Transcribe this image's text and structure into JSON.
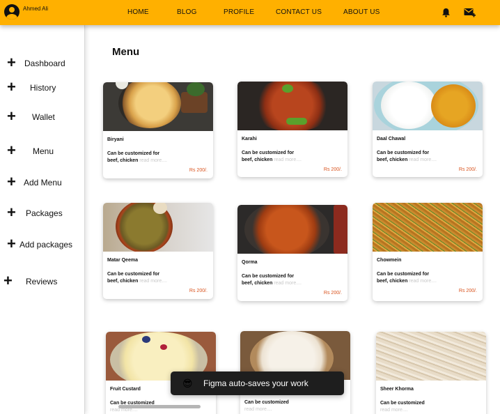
{
  "user": {
    "name": "Ahmed Ali"
  },
  "nav": [
    {
      "label": "HOME"
    },
    {
      "label": "BLOG"
    },
    {
      "label": "PROFILE"
    },
    {
      "label": "CONTACT US"
    },
    {
      "label": "ABOUT US"
    }
  ],
  "icons": {
    "notifications": "bell-icon",
    "messages": "mail-plus-icon",
    "avatar": "user-avatar-icon"
  },
  "sidebar": {
    "items": [
      {
        "label": "Dashboard"
      },
      {
        "label": "History"
      },
      {
        "label": "Wallet"
      },
      {
        "label": "Menu"
      },
      {
        "label": "Add Menu"
      },
      {
        "label": "Packages"
      },
      {
        "label": "Add packages"
      },
      {
        "label": "Reviews"
      }
    ]
  },
  "main": {
    "title": "Menu",
    "cards": [
      {
        "name": "Biryani",
        "desc1": "Can be customized for",
        "desc2": "beef, chicken",
        "more": "read more....",
        "price": "Rs 200/."
      },
      {
        "name": "Karahi",
        "desc1": "Can be customized for",
        "desc2": "beef, chicken",
        "more": "read more....",
        "price": "Rs 200/."
      },
      {
        "name": "Daal Chawal",
        "desc1": "Can be customized for",
        "desc2": "beef, chicken",
        "more": "read more....",
        "price": "Rs 200/."
      },
      {
        "name": "Matar Qeema",
        "desc1": "Can be customized for",
        "desc2": "beef, chicken",
        "more": "read more....",
        "price": "Rs 200/."
      },
      {
        "name": "Qorma",
        "desc1": "Can be customized for",
        "desc2": "beef, chicken",
        "more": "read more....",
        "price": "Rs 200/."
      },
      {
        "name": "Chowmein",
        "desc1": "Can be customized for",
        "desc2": "beef, chicken",
        "more": "read more....",
        "price": "Rs 200/."
      },
      {
        "name": "Fruit Custard",
        "desc1": "Can be customized",
        "more": "read more...."
      },
      {
        "name": "",
        "desc1": "Can be customized",
        "more": "read more...."
      },
      {
        "name": "Sheer Khorma",
        "desc1": "Can be customized",
        "more": "read more...."
      }
    ]
  },
  "toast": {
    "emoji": "😎",
    "message": "Figma auto-saves your work"
  },
  "colors": {
    "header": "#FFB000",
    "price": "#d9531e",
    "toast_bg": "#1e1e1e"
  }
}
